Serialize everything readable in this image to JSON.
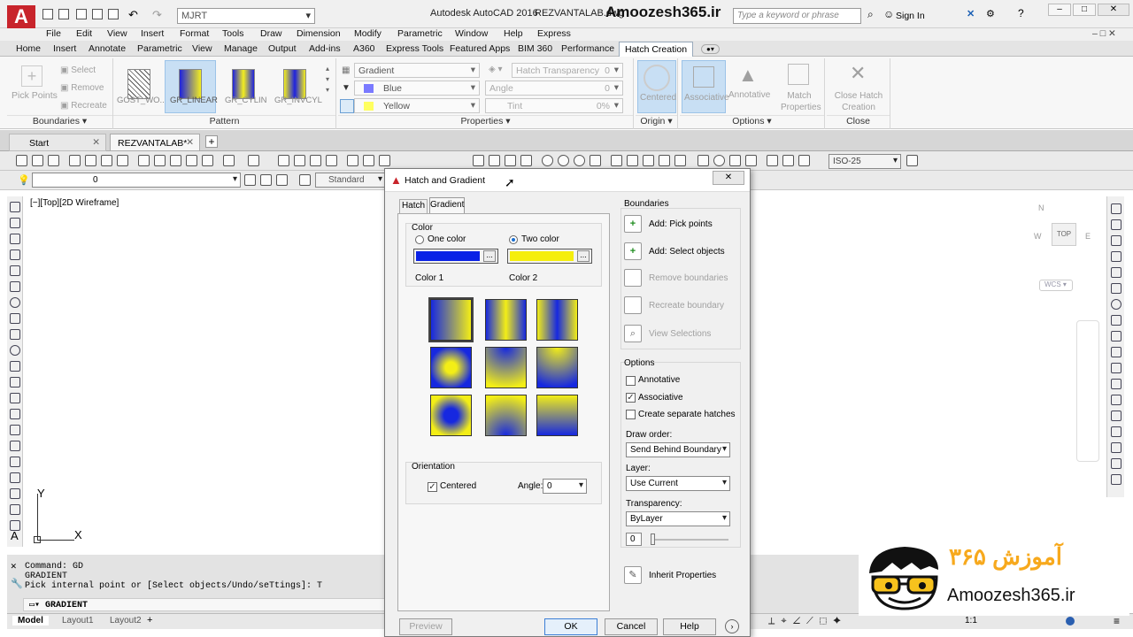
{
  "titlebar": {
    "workspace": "MJRT",
    "app": "Autodesk AutoCAD 2016",
    "file": "REZVANTALAB.dwg",
    "brand": "Amoozesh365.ir",
    "search_placeholder": "Type a keyword or phrase",
    "sign_in": "Sign In"
  },
  "menu": [
    "File",
    "Edit",
    "View",
    "Insert",
    "Format",
    "Tools",
    "Draw",
    "Dimension",
    "Modify",
    "Parametric",
    "Window",
    "Help",
    "Express"
  ],
  "ribbon_tabs": [
    "Home",
    "Insert",
    "Annotate",
    "Parametric",
    "View",
    "Manage",
    "Output",
    "Add-ins",
    "A360",
    "Express Tools",
    "Featured Apps",
    "BIM 360",
    "Performance",
    "Hatch Creation"
  ],
  "ribbon": {
    "boundaries": {
      "pick_points": "Pick Points",
      "select": "Select",
      "remove": "Remove",
      "recreate": "Recreate",
      "title": "Boundaries"
    },
    "pattern": {
      "swatches": [
        "GOST_WO...",
        "GR_LINEAR",
        "GR_CYLIN",
        "GR_INVCYL"
      ],
      "title": "Pattern"
    },
    "properties": {
      "type": "Gradient",
      "color1": "Blue",
      "color2": "Yellow",
      "transparency_label": "Hatch Transparency",
      "transparency_value": "0",
      "angle_label": "Angle",
      "angle_value": "0",
      "tint_label": "Tint",
      "tint_value": "0%",
      "title": "Properties"
    },
    "origin": {
      "centered": "Centered",
      "title": "Origin"
    },
    "options": {
      "associative": "Associative",
      "annotative": "Annotative",
      "match": "Match Properties",
      "title": "Options"
    },
    "close": {
      "label": "Close Hatch Creation",
      "title": "Close"
    }
  },
  "doc_tabs": [
    "Start",
    "REZVANTALAB*"
  ],
  "toolbar2": {
    "layer": "0",
    "style": "Standard",
    "dimstyle": "ISO-25"
  },
  "viewport": {
    "label": "[−][Top][2D Wireframe]",
    "axis_y": "Y",
    "axis_x": "X",
    "wcs": "WCS",
    "view_cube": {
      "top": "TOP",
      "n": "N",
      "w": "W",
      "e": "E"
    }
  },
  "command": {
    "lines": [
      "Command: GD",
      "GRADIENT",
      "Pick internal point or [Select objects/Undo/seTtings]: T"
    ],
    "prompt": "GRADIENT"
  },
  "status": {
    "tabs": [
      "Model",
      "Layout1",
      "Layout2"
    ],
    "scale": "1:1"
  },
  "dialog": {
    "title": "Hatch and Gradient",
    "tabs": [
      "Hatch",
      "Gradient"
    ],
    "color": {
      "legend": "Color",
      "one_color": "One color",
      "two_color": "Two color",
      "color1_label": "Color 1",
      "color2_label": "Color 2",
      "color1": "#0a22e6",
      "color2": "#f5ee0c",
      "selected": "Two color"
    },
    "orientation": {
      "legend": "Orientation",
      "centered": "Centered",
      "centered_checked": true,
      "angle_label": "Angle:",
      "angle_value": "0"
    },
    "boundaries": {
      "legend": "Boundaries",
      "add_pick": "Add: Pick points",
      "add_select": "Add: Select objects",
      "remove": "Remove boundaries",
      "recreate": "Recreate boundary",
      "view": "View Selections"
    },
    "options": {
      "legend": "Options",
      "annotative": "Annotative",
      "annotative_checked": false,
      "associative": "Associative",
      "associative_checked": true,
      "separate": "Create separate hatches",
      "separate_checked": false,
      "draw_order_label": "Draw order:",
      "draw_order": "Send Behind Boundary",
      "layer_label": "Layer:",
      "layer": "Use Current",
      "transparency_label": "Transparency:",
      "transparency": "ByLayer",
      "transparency_value": "0"
    },
    "inherit": "Inherit Properties",
    "buttons": {
      "preview": "Preview",
      "ok": "OK",
      "cancel": "Cancel",
      "help": "Help"
    }
  },
  "watermark": {
    "site": "Amoozesh365.ir",
    "persian": "آموزش ۳۶۵"
  }
}
